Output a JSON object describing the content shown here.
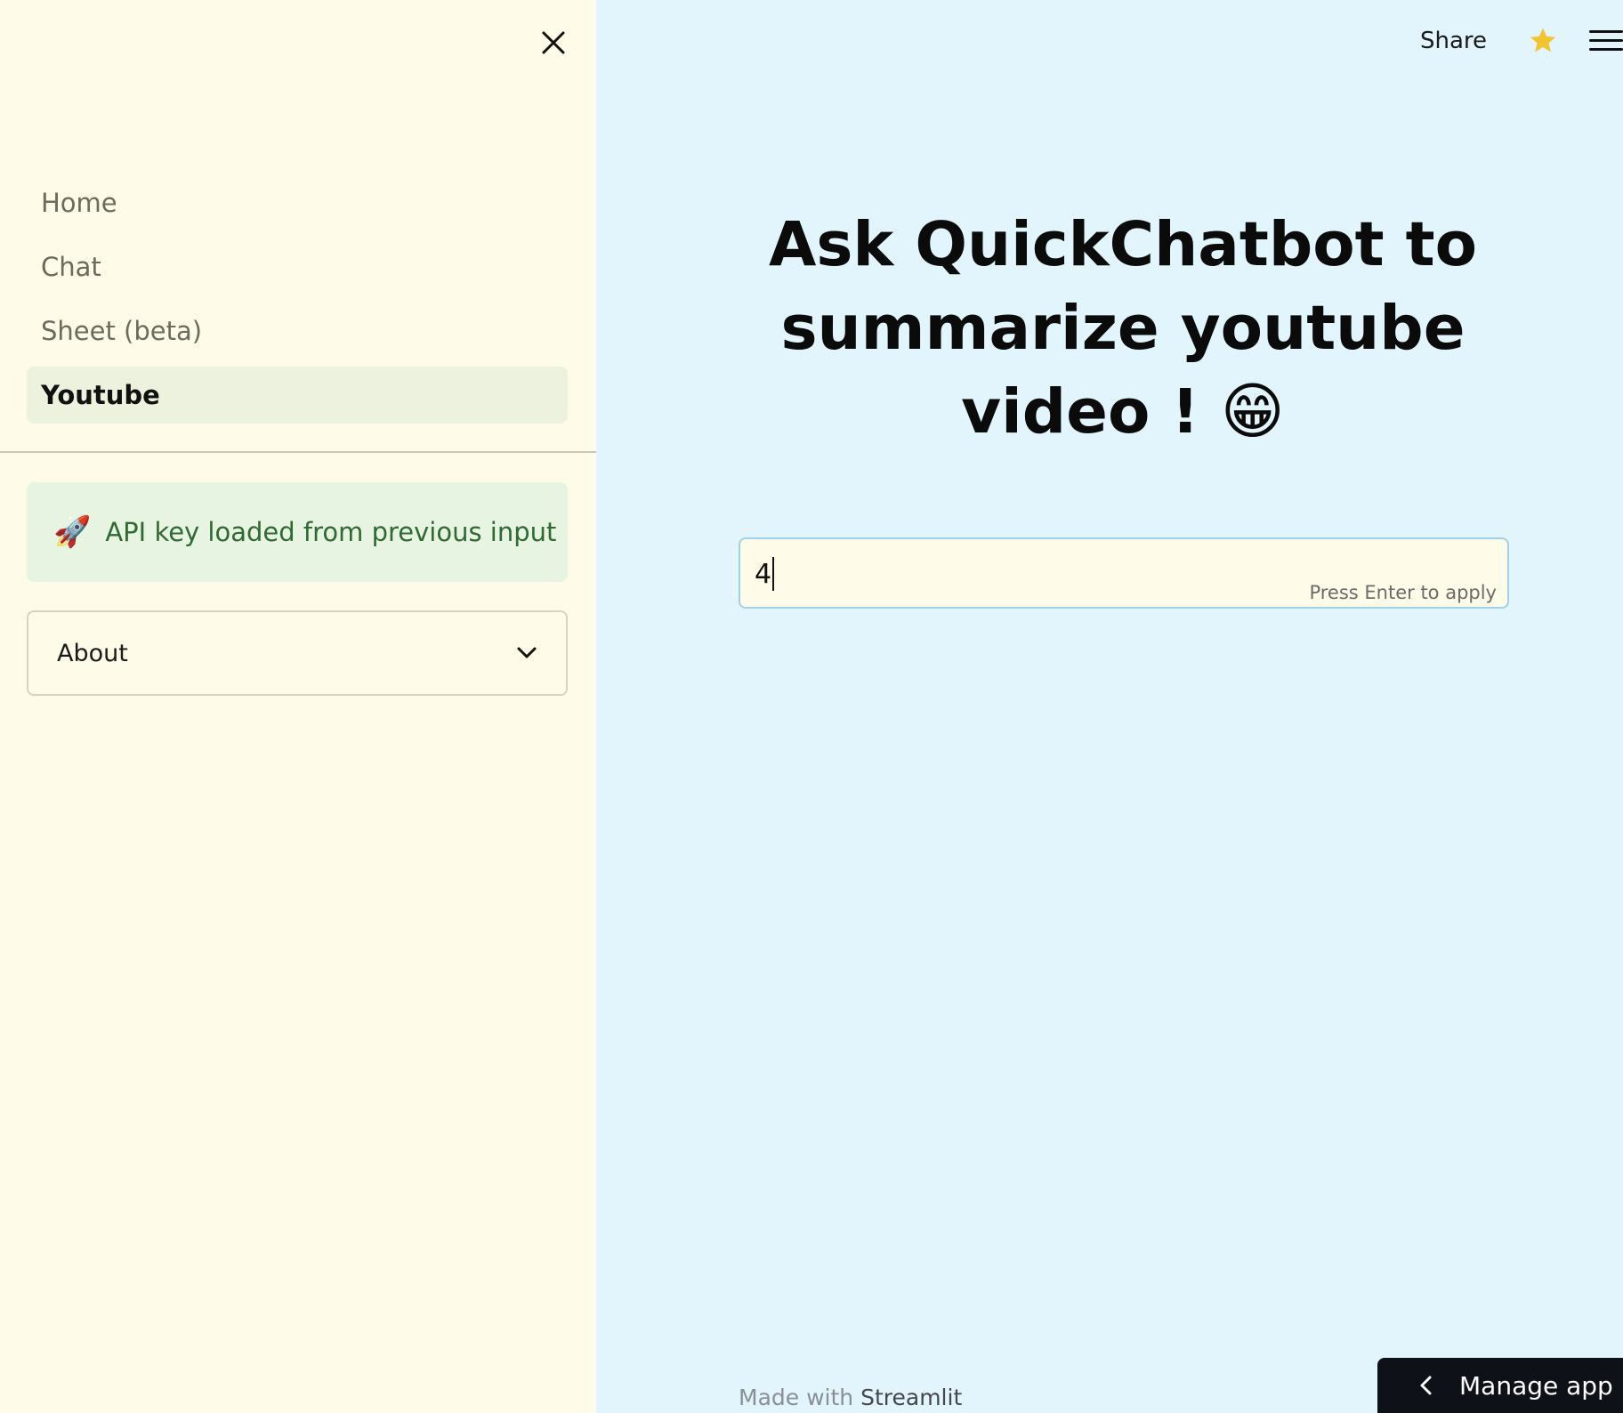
{
  "sidebar": {
    "nav_items": [
      {
        "label": "Home",
        "active": false
      },
      {
        "label": "Chat",
        "active": false
      },
      {
        "label": "Sheet (beta)",
        "active": false
      },
      {
        "label": "Youtube",
        "active": true
      }
    ],
    "alert": {
      "icon": "rocket-icon",
      "text": "API key loaded from previous input"
    },
    "expander": {
      "label": "About"
    }
  },
  "header": {
    "share_label": "Share"
  },
  "main": {
    "title": "Ask QuickChatbot to summarize youtube video ! 😁",
    "input": {
      "value": "4",
      "hint": "Press Enter to apply"
    }
  },
  "footer": {
    "made_with": "Made with",
    "brand": "Streamlit"
  },
  "manage_app": {
    "label": "Manage app"
  },
  "colors": {
    "sidebar_bg": "#fefce8",
    "main_bg": "#e2f5fc",
    "success_bg": "#e7f4e1",
    "success_text": "#2f6a33",
    "star": "#f4c430"
  }
}
